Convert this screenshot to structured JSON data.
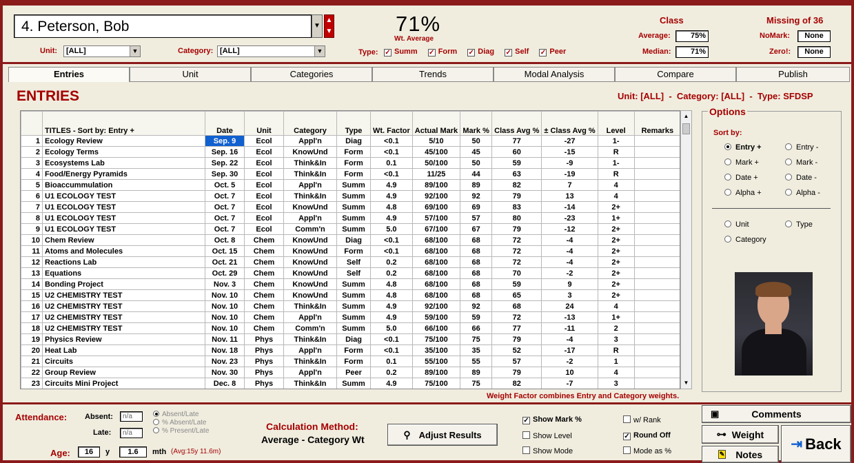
{
  "header": {
    "student": "4. Peterson, Bob",
    "unit_label": "Unit:",
    "unit_value": "[ALL]",
    "category_label": "Category:",
    "category_value": "[ALL]",
    "percent": "71%",
    "percent_sub": "Wt. Average",
    "type_label": "Type:",
    "types": [
      "Summ",
      "Form",
      "Diag",
      "Self",
      "Peer"
    ],
    "class_title": "Class",
    "average_label": "Average:",
    "average_value": "75%",
    "median_label": "Median:",
    "median_value": "71%",
    "missing_title": "Missing of 36",
    "nomark_label": "NoMark:",
    "nomark_value": "None",
    "zero_label": "Zero!:",
    "zero_value": "None"
  },
  "tabs": [
    "Entries",
    "Unit",
    "Categories",
    "Trends",
    "Modal Analysis",
    "Compare",
    "Publish"
  ],
  "section_title": "ENTRIES",
  "filter_summary": "Unit: [ALL]  -  Category: [ALL]  -  Type: SFDSP",
  "table": {
    "columns": [
      "",
      "TITLES - Sort by: Entry +",
      "Date",
      "Unit",
      "Category",
      "Type",
      "Wt. Factor",
      "Actual Mark",
      "Mark %",
      "Class Avg %",
      "± Class Avg %",
      "Level",
      "Remarks"
    ],
    "rows": [
      [
        "1",
        "Ecology Review",
        "Sep. 9",
        "Ecol",
        "Appl'n",
        "Diag",
        "<0.1",
        "5/10",
        "50",
        "77",
        "-27",
        "1-"
      ],
      [
        "2",
        "Ecology Terms",
        "Sep. 16",
        "Ecol",
        "KnowUnd",
        "Form",
        "<0.1",
        "45/100",
        "45",
        "60",
        "-15",
        "R"
      ],
      [
        "3",
        "Ecosystems Lab",
        "Sep. 22",
        "Ecol",
        "Think&In",
        "Form",
        "0.1",
        "50/100",
        "50",
        "59",
        "-9",
        "1-"
      ],
      [
        "4",
        "Food/Energy Pyramids",
        "Sep. 30",
        "Ecol",
        "Think&In",
        "Form",
        "<0.1",
        "11/25",
        "44",
        "63",
        "-19",
        "R"
      ],
      [
        "5",
        "Bioaccummulation",
        "Oct. 5",
        "Ecol",
        "Appl'n",
        "Summ",
        "4.9",
        "89/100",
        "89",
        "82",
        "7",
        "4"
      ],
      [
        "6",
        "U1 ECOLOGY TEST",
        "Oct. 7",
        "Ecol",
        "Think&In",
        "Summ",
        "4.9",
        "92/100",
        "92",
        "79",
        "13",
        "4"
      ],
      [
        "7",
        "U1 ECOLOGY TEST",
        "Oct. 7",
        "Ecol",
        "KnowUnd",
        "Summ",
        "4.8",
        "69/100",
        "69",
        "83",
        "-14",
        "2+"
      ],
      [
        "8",
        "U1 ECOLOGY TEST",
        "Oct. 7",
        "Ecol",
        "Appl'n",
        "Summ",
        "4.9",
        "57/100",
        "57",
        "80",
        "-23",
        "1+"
      ],
      [
        "9",
        "U1 ECOLOGY TEST",
        "Oct. 7",
        "Ecol",
        "Comm'n",
        "Summ",
        "5.0",
        "67/100",
        "67",
        "79",
        "-12",
        "2+"
      ],
      [
        "10",
        "Chem Review",
        "Oct. 8",
        "Chem",
        "KnowUnd",
        "Diag",
        "<0.1",
        "68/100",
        "68",
        "72",
        "-4",
        "2+"
      ],
      [
        "11",
        "Atoms and Molecules",
        "Oct. 15",
        "Chem",
        "KnowUnd",
        "Form",
        "<0.1",
        "68/100",
        "68",
        "72",
        "-4",
        "2+"
      ],
      [
        "12",
        "Reactions Lab",
        "Oct. 21",
        "Chem",
        "KnowUnd",
        "Self",
        "0.2",
        "68/100",
        "68",
        "72",
        "-4",
        "2+"
      ],
      [
        "13",
        "Equations",
        "Oct. 29",
        "Chem",
        "KnowUnd",
        "Self",
        "0.2",
        "68/100",
        "68",
        "70",
        "-2",
        "2+"
      ],
      [
        "14",
        "Bonding Project",
        "Nov. 3",
        "Chem",
        "KnowUnd",
        "Summ",
        "4.8",
        "68/100",
        "68",
        "59",
        "9",
        "2+"
      ],
      [
        "15",
        "U2 CHEMISTRY TEST",
        "Nov. 10",
        "Chem",
        "KnowUnd",
        "Summ",
        "4.8",
        "68/100",
        "68",
        "65",
        "3",
        "2+"
      ],
      [
        "16",
        "U2 CHEMISTRY TEST",
        "Nov. 10",
        "Chem",
        "Think&In",
        "Summ",
        "4.9",
        "92/100",
        "92",
        "68",
        "24",
        "4"
      ],
      [
        "17",
        "U2 CHEMISTRY TEST",
        "Nov. 10",
        "Chem",
        "Appl'n",
        "Summ",
        "4.9",
        "59/100",
        "59",
        "72",
        "-13",
        "1+"
      ],
      [
        "18",
        "U2 CHEMISTRY TEST",
        "Nov. 10",
        "Chem",
        "Comm'n",
        "Summ",
        "5.0",
        "66/100",
        "66",
        "77",
        "-11",
        "2"
      ],
      [
        "19",
        "Physics Review",
        "Nov. 11",
        "Phys",
        "Think&In",
        "Diag",
        "<0.1",
        "75/100",
        "75",
        "79",
        "-4",
        "3"
      ],
      [
        "20",
        "Heat Lab",
        "Nov. 18",
        "Phys",
        "Appl'n",
        "Form",
        "<0.1",
        "35/100",
        "35",
        "52",
        "-17",
        "R"
      ],
      [
        "21",
        "Circuits",
        "Nov. 23",
        "Phys",
        "Think&In",
        "Form",
        "0.1",
        "55/100",
        "55",
        "57",
        "-2",
        "1"
      ],
      [
        "22",
        "Group Review",
        "Nov. 30",
        "Phys",
        "Appl'n",
        "Peer",
        "0.2",
        "89/100",
        "89",
        "79",
        "10",
        "4"
      ],
      [
        "23",
        "Circuits Mini Project",
        "Dec. 8",
        "Phys",
        "Think&In",
        "Summ",
        "4.9",
        "75/100",
        "75",
        "82",
        "-7",
        "3"
      ]
    ]
  },
  "weight_note": "Weight Factor combines Entry and Category weights.",
  "options": {
    "title": "Options",
    "sort_by": "Sort by:",
    "sort": [
      "Entry +",
      "Entry -",
      "Mark +",
      "Mark -",
      "Date +",
      "Date -",
      "Alpha +",
      "Alpha -"
    ],
    "group": [
      "Unit",
      "Type",
      "Category"
    ]
  },
  "bottom": {
    "attendance": "Attendance:",
    "absent_label": "Absent:",
    "absent_value": "n/a",
    "late_label": "Late:",
    "late_value": "n/a",
    "att_opts": [
      "Absent/Late",
      "% Absent/Late",
      "% Present/Late"
    ],
    "age_label": "Age:",
    "age_years": "16",
    "y": "y",
    "age_months": "1.6",
    "mth": "mth",
    "age_avg": "(Avg:15y 11.6m)",
    "calc_title": "Calculation Method:",
    "calc_value": "Average - Category Wt",
    "adjust": "Adjust Results",
    "checks": [
      "Show Mark %",
      "Show Level",
      "Show Mode",
      "w/ Rank",
      "Round Off",
      "Mode as %"
    ],
    "comments": "Comments",
    "weight": "Weight",
    "notes": "Notes",
    "back": "Back"
  },
  "colors": {
    "accent": "#a50000",
    "frame": "#8b1a1a",
    "highlight": "#1060d0"
  }
}
